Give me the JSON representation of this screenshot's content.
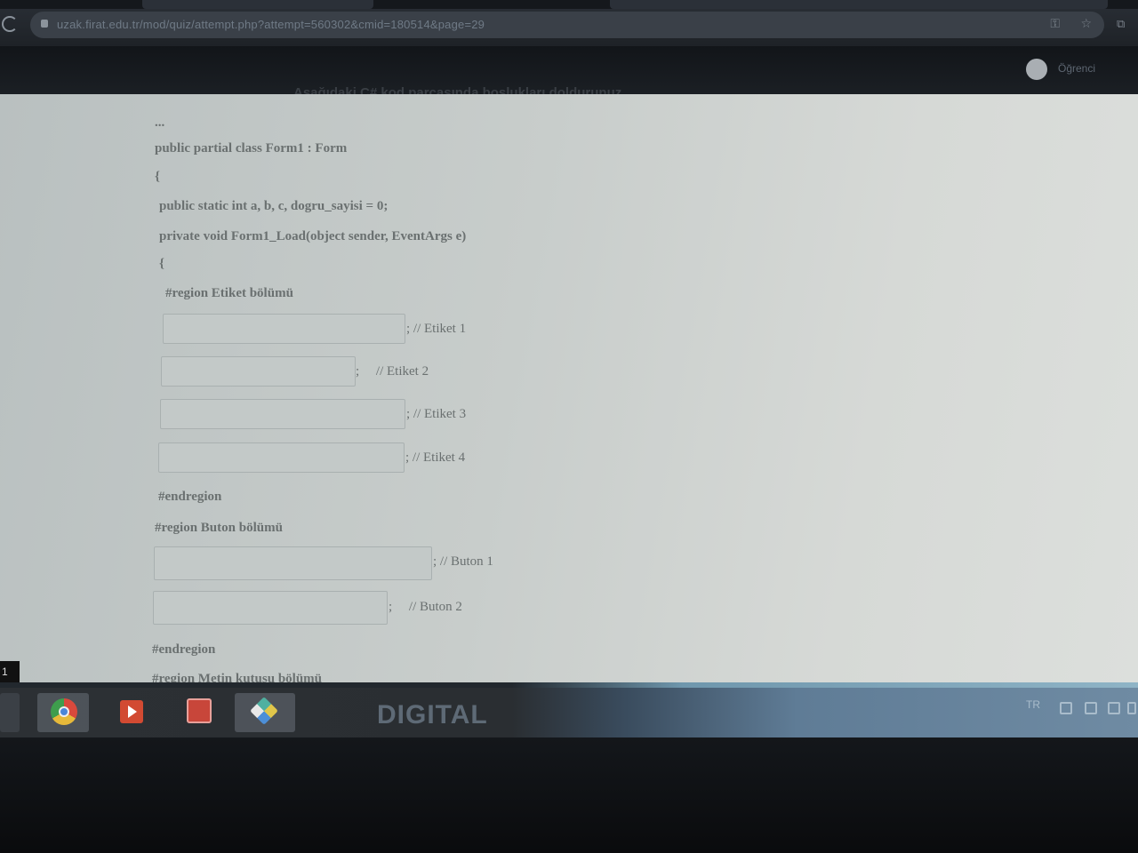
{
  "browser": {
    "url": "uzak.firat.edu.tr/mod/quiz/attempt.php?attempt=560302&cmid=180514&page=29",
    "icons": [
      "reload-icon",
      "lock-icon",
      "key-icon",
      "star-icon",
      "extension-icon"
    ]
  },
  "site_header": {
    "user_name": "Öğrenci",
    "question_heading": "Aşağıdaki C# kod parçasında boşlukları doldurunuz."
  },
  "code": {
    "comment_line": "...",
    "class_decl": "public partial class Form1 : Form",
    "open_brace_1": "{",
    "fields": "public static int a, b, c, dogru_sayisi = 0;",
    "method": "private void Form1_Load(object sender, EventArgs e)",
    "open_brace_2": "{",
    "region_labels": "#region Etiket bölümü",
    "label_blanks": [
      {
        "value": "",
        "suffix": "; // Etiket 1"
      },
      {
        "value": "",
        "suffix": ";     // Etiket 2"
      },
      {
        "value": "",
        "suffix": "; // Etiket 3"
      },
      {
        "value": "",
        "suffix": "; // Etiket 4"
      }
    ],
    "endregion_1": "#endregion",
    "region_buttons": "#region Buton bölümü",
    "button_blanks": [
      {
        "value": "",
        "suffix": "; // Buton 1"
      },
      {
        "value": "",
        "suffix": ";     // Buton 2"
      }
    ],
    "endregion_2": "#endregion",
    "region_textbox": "#region Metin kutusu bölümü"
  },
  "page_marker": "1",
  "taskbar": {
    "apps": [
      "chrome-icon",
      "media-player-icon",
      "chart-app-icon",
      "cube-app-icon"
    ],
    "wallpaper_text": "DIGITAL",
    "language": "TR"
  }
}
